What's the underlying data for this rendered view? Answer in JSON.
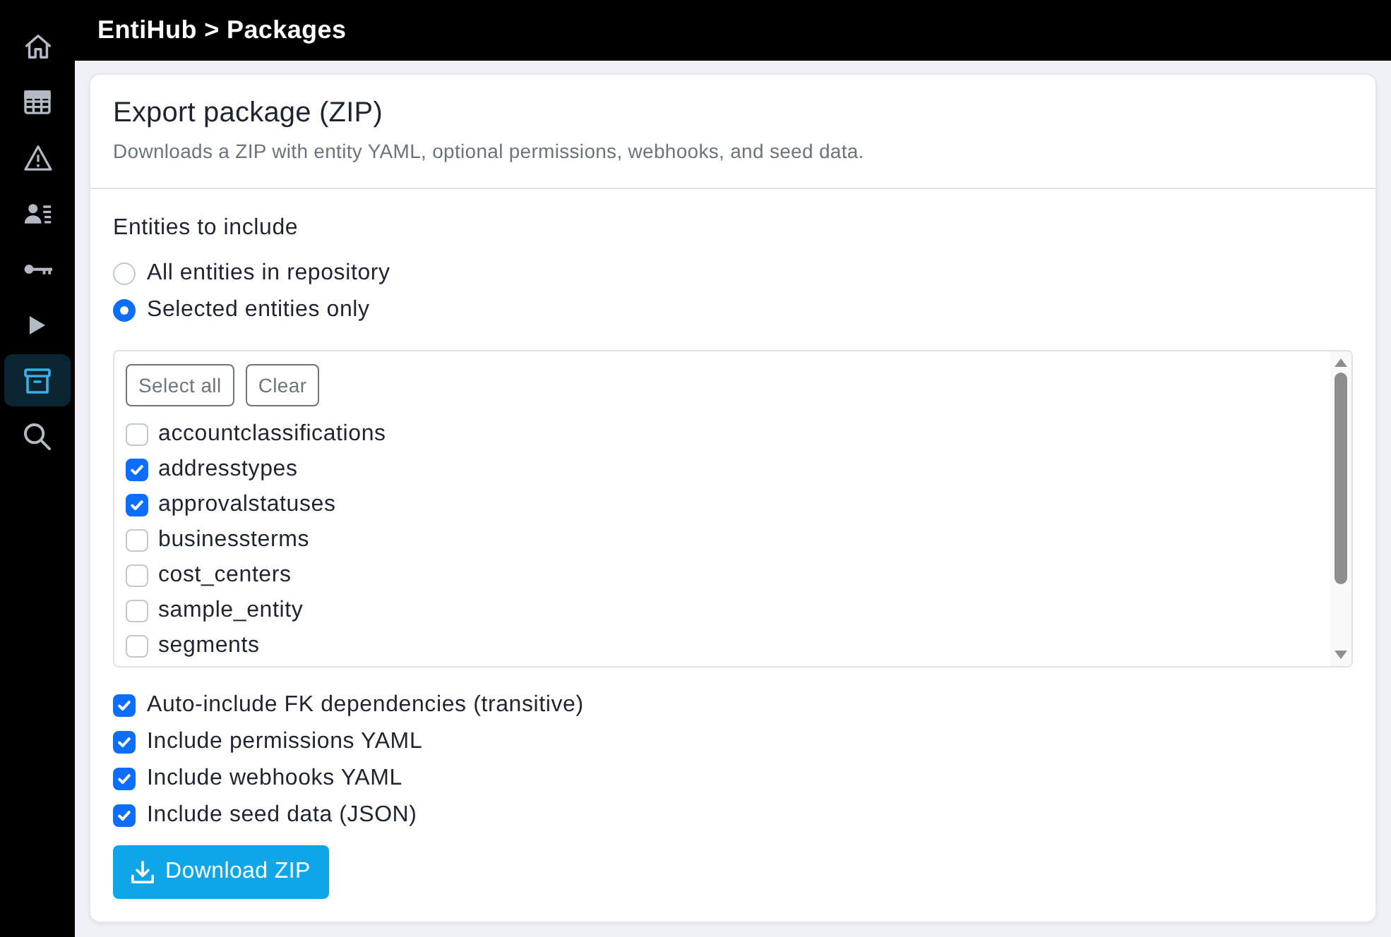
{
  "sidebar": {
    "items": [
      {
        "kind": "home",
        "selected": false
      },
      {
        "kind": "table",
        "selected": false
      },
      {
        "kind": "warning",
        "selected": false
      },
      {
        "kind": "people",
        "selected": false
      },
      {
        "kind": "key",
        "selected": false
      },
      {
        "kind": "play",
        "selected": false
      },
      {
        "kind": "archive",
        "selected": true
      },
      {
        "kind": "search",
        "selected": false
      }
    ]
  },
  "header": {
    "title": "EntiHub > Packages"
  },
  "card": {
    "title": "Export package (ZIP)",
    "subtitle": "Downloads a ZIP with entity YAML, optional permissions, webhooks, and seed data."
  },
  "entities": {
    "label": "Entities to include",
    "scope_options": [
      {
        "label": "All entities in repository",
        "selected": false
      },
      {
        "label": "Selected entities only",
        "selected": true
      }
    ],
    "list_buttons": [
      "Select all",
      "Clear"
    ],
    "items": [
      {
        "label": "accountclassifications",
        "checked": false
      },
      {
        "label": "addresstypes",
        "checked": true
      },
      {
        "label": "approvalstatuses",
        "checked": true
      },
      {
        "label": "businessterms",
        "checked": false
      },
      {
        "label": "cost_centers",
        "checked": false
      },
      {
        "label": "sample_entity",
        "checked": false
      },
      {
        "label": "segments",
        "checked": false
      }
    ]
  },
  "options": [
    {
      "label": "Auto-include FK dependencies (transitive)",
      "checked": true
    },
    {
      "label": "Include permissions YAML",
      "checked": true
    },
    {
      "label": "Include webhooks YAML",
      "checked": true
    },
    {
      "label": "Include seed data (JSON)",
      "checked": true
    }
  ],
  "download_button": {
    "label": "Download ZIP"
  }
}
